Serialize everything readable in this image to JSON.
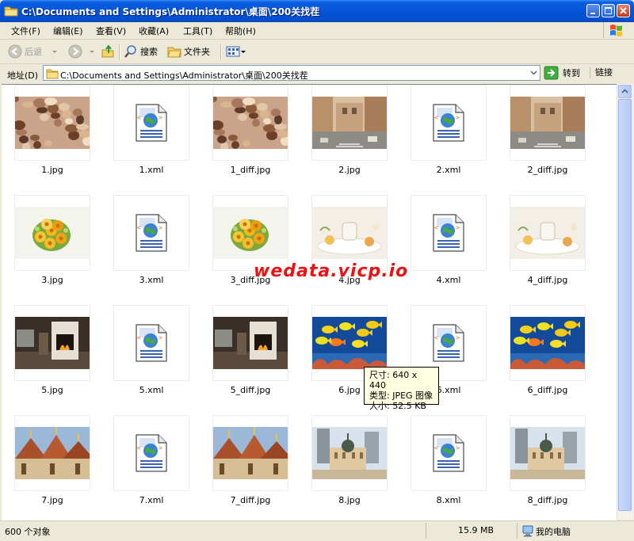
{
  "window": {
    "title": "C:\\Documents and Settings\\Administrator\\桌面\\200关找茬",
    "title_icon": "folder-icon",
    "colors": {
      "titlebar": "#0454D6",
      "frame": "#ECE9D8",
      "close": "#C2391F"
    }
  },
  "menu": {
    "items": [
      {
        "label": "文件(F)"
      },
      {
        "label": "编辑(E)"
      },
      {
        "label": "查看(V)"
      },
      {
        "label": "收藏(A)"
      },
      {
        "label": "工具(T)"
      },
      {
        "label": "帮助(H)"
      }
    ]
  },
  "toolbar": {
    "back_label": "后退",
    "search_label": "搜索",
    "folders_label": "文件夹"
  },
  "address": {
    "label": "地址(D)",
    "value": "C:\\Documents and Settings\\Administrator\\桌面\\200关找茬",
    "go_label": "转到",
    "links_label": "链接"
  },
  "files": [
    {
      "name": "1.jpg",
      "kind": "image-shells"
    },
    {
      "name": "1.xml",
      "kind": "xml-icon"
    },
    {
      "name": "1_diff.jpg",
      "kind": "image-shells"
    },
    {
      "name": "2.jpg",
      "kind": "image-street"
    },
    {
      "name": "2.xml",
      "kind": "xml-icon"
    },
    {
      "name": "2_diff.jpg",
      "kind": "image-street"
    },
    {
      "name": "3.jpg",
      "kind": "image-flowers"
    },
    {
      "name": "3.xml",
      "kind": "xml-icon"
    },
    {
      "name": "3_diff.jpg",
      "kind": "image-flowers"
    },
    {
      "name": "4.jpg",
      "kind": "image-tea"
    },
    {
      "name": "4.xml",
      "kind": "xml-icon"
    },
    {
      "name": "4_diff.jpg",
      "kind": "image-tea"
    },
    {
      "name": "5.jpg",
      "kind": "image-fireplace"
    },
    {
      "name": "5.xml",
      "kind": "xml-icon"
    },
    {
      "name": "5_diff.jpg",
      "kind": "image-fireplace"
    },
    {
      "name": "6.jpg",
      "kind": "image-fish"
    },
    {
      "name": "6.xml",
      "kind": "xml-icon"
    },
    {
      "name": "6_diff.jpg",
      "kind": "image-fish"
    },
    {
      "name": "7.jpg",
      "kind": "image-temple"
    },
    {
      "name": "7.xml",
      "kind": "xml-icon"
    },
    {
      "name": "7_diff.jpg",
      "kind": "image-temple"
    },
    {
      "name": "8.jpg",
      "kind": "image-towers"
    },
    {
      "name": "8.xml",
      "kind": "xml-icon"
    },
    {
      "name": "8_diff.jpg",
      "kind": "image-towers"
    }
  ],
  "tooltip": {
    "size": "尺寸: 640 x 440",
    "type": "类型: JPEG 图像",
    "filesize": "大小: 52.5 KB"
  },
  "watermark": "wedata.vicp.io",
  "status": {
    "count": "600 个对象",
    "size": "15.9 MB",
    "location": "我的电脑"
  }
}
